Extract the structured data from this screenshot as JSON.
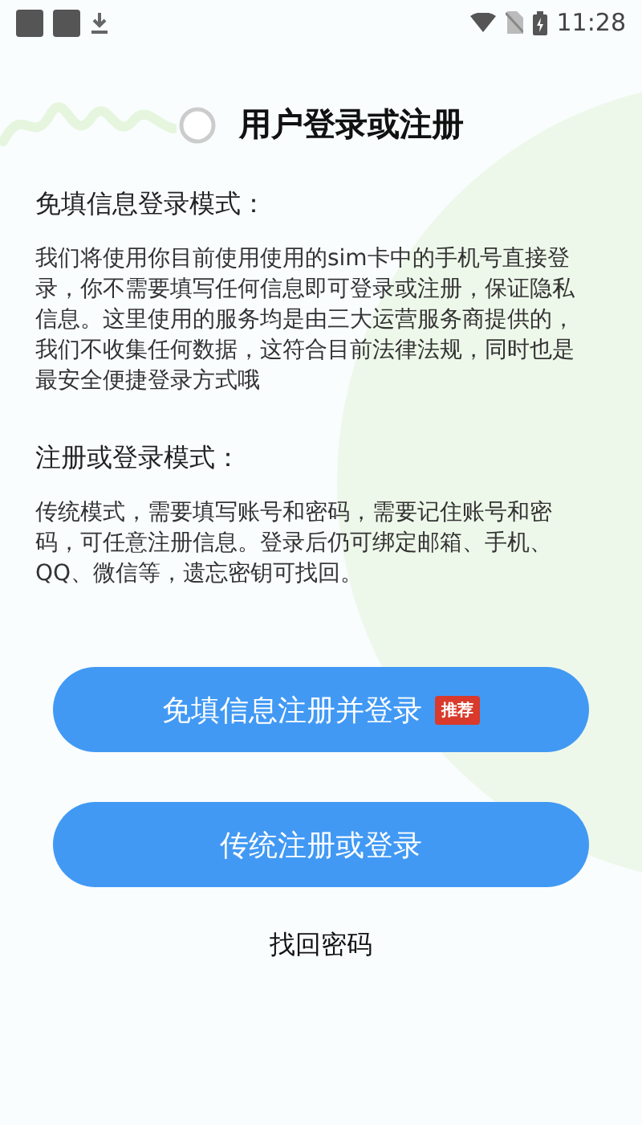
{
  "status_bar": {
    "time": "11:28"
  },
  "title": "用户登录或注册",
  "sections": [
    {
      "heading": "免填信息登录模式：",
      "body": "我们将使用你目前使用使用的sim卡中的手机号直接登录，你不需要填写任何信息即可登录或注册，保证隐私信息。这里使用的服务均是由三大运营服务商提供的，我们不收集任何数据，这符合目前法律法规，同时也是最安全便捷登录方式哦"
    },
    {
      "heading": "注册或登录模式：",
      "body": "传统模式，需要填写账号和密码，需要记住账号和密码，可任意注册信息。登录后仍可绑定邮箱、手机、QQ、微信等，遗忘密钥可找回。"
    }
  ],
  "buttons": [
    {
      "label": "免填信息注册并登录",
      "badge": "推荐"
    },
    {
      "label": "传统注册或登录"
    }
  ],
  "link": "找回密码"
}
